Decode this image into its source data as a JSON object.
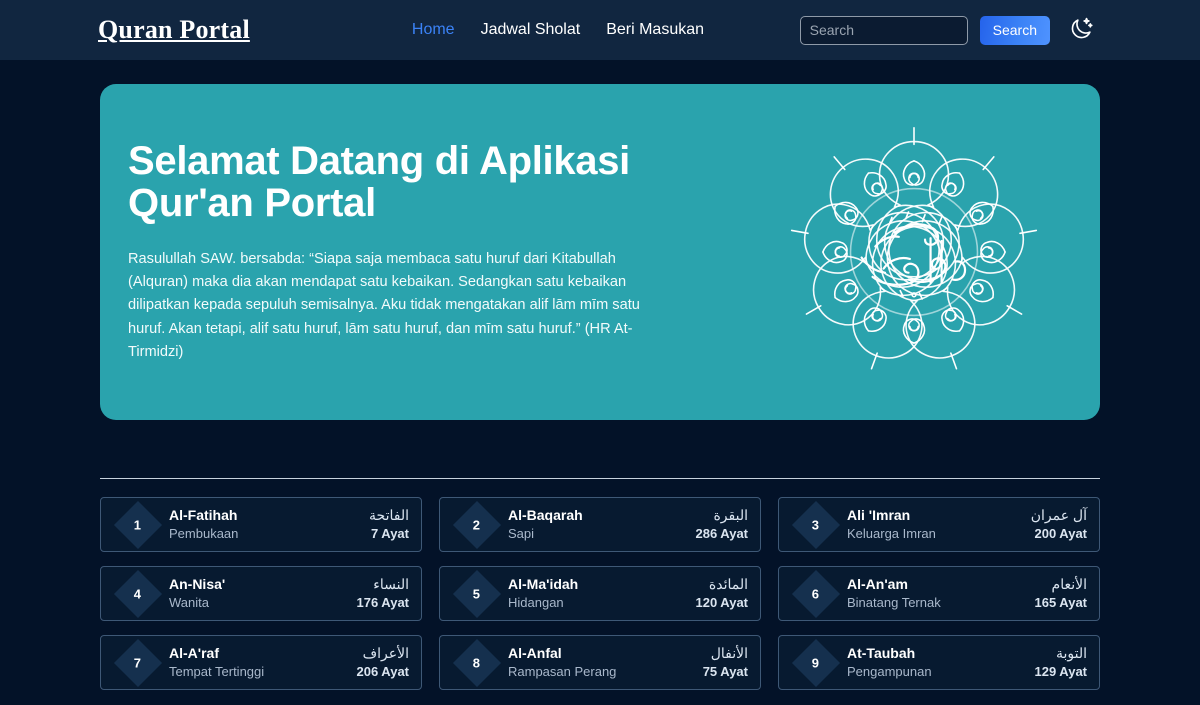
{
  "navbar": {
    "brand": "Quran Portal",
    "links": [
      {
        "label": "Home",
        "active": true
      },
      {
        "label": "Jadwal Sholat",
        "active": false
      },
      {
        "label": "Beri Masukan",
        "active": false
      }
    ],
    "search": {
      "placeholder": "Search",
      "value": "",
      "button_label": "Search"
    },
    "theme_toggle_icon": "moon-stars-icon",
    "accent_color": "#3b82f6",
    "background_color": "#112640"
  },
  "hero": {
    "title": "Selamat Datang di Aplikasi Qur'an Portal",
    "description": "Rasulullah SAW. bersabda: “Siapa saja membaca satu huruf dari Kitabullah (Alquran) maka dia akan mendapat satu kebaikan. Sedangkan satu kebaikan dilipatkan kepada sepuluh semisalnya. Aku tidak mengatakan alif lām mīm satu huruf. Akan tetapi, alif satu huruf, lām satu huruf, dan mīm satu huruf.” (HR At-Tirmidzi)",
    "artwork_icon": "quran-calligraphy-ornament-icon",
    "background_color": "#2aa3ad"
  },
  "surah_list": [
    {
      "number": "1",
      "latin": "Al-Fatihah",
      "meaning": "Pembukaan",
      "arabic": "الفاتحة",
      "ayat": "7 Ayat"
    },
    {
      "number": "2",
      "latin": "Al-Baqarah",
      "meaning": "Sapi",
      "arabic": "البقرة",
      "ayat": "286 Ayat"
    },
    {
      "number": "3",
      "latin": "Ali 'Imran",
      "meaning": "Keluarga Imran",
      "arabic": "آل عمران",
      "ayat": "200 Ayat"
    },
    {
      "number": "4",
      "latin": "An-Nisa'",
      "meaning": "Wanita",
      "arabic": "النساء",
      "ayat": "176 Ayat"
    },
    {
      "number": "5",
      "latin": "Al-Ma'idah",
      "meaning": "Hidangan",
      "arabic": "المائدة",
      "ayat": "120 Ayat"
    },
    {
      "number": "6",
      "latin": "Al-An'am",
      "meaning": "Binatang Ternak",
      "arabic": "الأنعام",
      "ayat": "165 Ayat"
    },
    {
      "number": "7",
      "latin": "Al-A'raf",
      "meaning": "Tempat Tertinggi",
      "arabic": "الأعراف",
      "ayat": "206 Ayat"
    },
    {
      "number": "8",
      "latin": "Al-Anfal",
      "meaning": "Rampasan Perang",
      "arabic": "الأنفال",
      "ayat": "75 Ayat"
    },
    {
      "number": "9",
      "latin": "At-Taubah",
      "meaning": "Pengampunan",
      "arabic": "التوبة",
      "ayat": "129 Ayat"
    }
  ]
}
